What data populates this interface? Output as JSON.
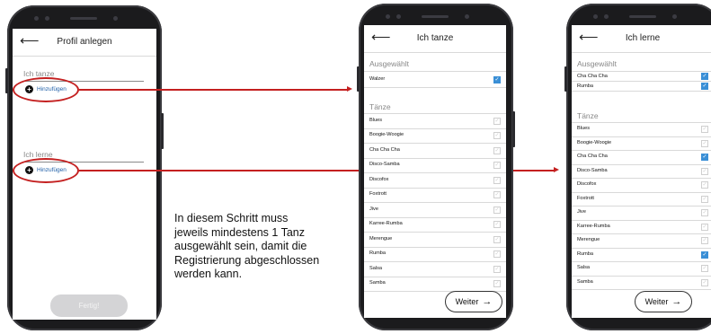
{
  "phone1": {
    "title": "Profil anlegen",
    "back": "⟵",
    "section_dance": "Ich tanze",
    "section_learn": "Ich lerne",
    "add_label": "Hinzufügen",
    "finish_label": "Fertig!"
  },
  "phone2": {
    "title": "Ich tanze",
    "back": "⟵",
    "selected_header": "Ausgewählt",
    "selected": [
      {
        "label": "Walzer",
        "checked": true
      }
    ],
    "dances_header": "Tänze",
    "dances": [
      {
        "label": "Blues",
        "checked": false
      },
      {
        "label": "Boogie-Woogie",
        "checked": false
      },
      {
        "label": "Cha Cha Cha",
        "checked": false
      },
      {
        "label": "Disco-Samba",
        "checked": false
      },
      {
        "label": "Discofox",
        "checked": false
      },
      {
        "label": "Foxtrott",
        "checked": false
      },
      {
        "label": "Jive",
        "checked": false
      },
      {
        "label": "Karree-Rumba",
        "checked": false
      },
      {
        "label": "Merengue",
        "checked": false
      },
      {
        "label": "Rumba",
        "checked": false
      },
      {
        "label": "Salsa",
        "checked": false
      },
      {
        "label": "Samba",
        "checked": false
      }
    ],
    "next_label": "Weiter"
  },
  "phone3": {
    "title": "Ich lerne",
    "back": "⟵",
    "selected_header": "Ausgewählt",
    "selected": [
      {
        "label": "Cha Cha Cha",
        "checked": true
      },
      {
        "label": "Rumba",
        "checked": true
      }
    ],
    "dances_header": "Tänze",
    "dances": [
      {
        "label": "Blues",
        "checked": false
      },
      {
        "label": "Boogie-Woogie",
        "checked": false
      },
      {
        "label": "Cha Cha Cha",
        "checked": true
      },
      {
        "label": "Disco-Samba",
        "checked": false
      },
      {
        "label": "Discofox",
        "checked": false
      },
      {
        "label": "Foxtrott",
        "checked": false
      },
      {
        "label": "Jive",
        "checked": false
      },
      {
        "label": "Karree-Rumba",
        "checked": false
      },
      {
        "label": "Merengue",
        "checked": false
      },
      {
        "label": "Rumba",
        "checked": true
      },
      {
        "label": "Salsa",
        "checked": false
      },
      {
        "label": "Samba",
        "checked": false
      }
    ],
    "next_label": "Weiter"
  },
  "note": {
    "lines": [
      "In diesem Schritt muss",
      "jeweils mindestens 1 Tanz",
      "ausgewählt sein, damit die",
      "Registrierung abgeschlossen",
      "werden kann."
    ]
  },
  "colors": {
    "highlight": "#c42020",
    "checkbox_on": "#3a8fd6",
    "link": "#1f5fa8"
  }
}
